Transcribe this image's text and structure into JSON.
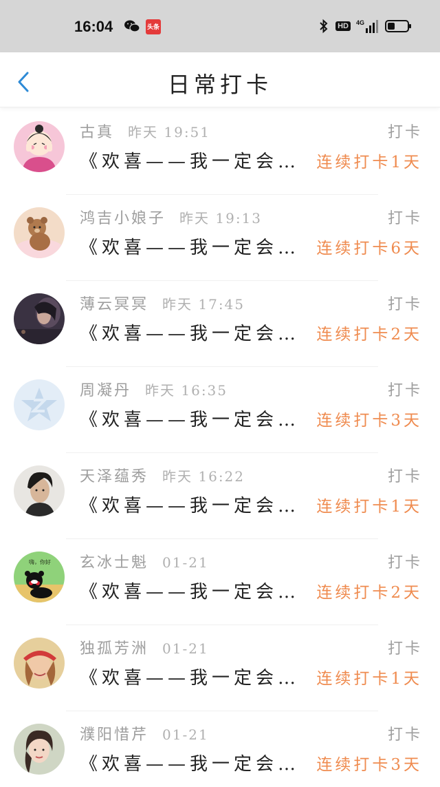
{
  "status_bar": {
    "time": "16:04",
    "toutiao_label": "头条",
    "network_label": "HD"
  },
  "nav": {
    "title": "日常打卡"
  },
  "colors": {
    "accent_orange": "#ef8b4f",
    "back_blue": "#2d8ad6"
  },
  "entries": [
    {
      "name": "古真",
      "time": "昨天 19:51",
      "tag": "打卡",
      "title": "《欢喜——我一定会带你去看极光》",
      "streak": "连续打卡1天",
      "avatar": "cartoon-girl"
    },
    {
      "name": "鸿吉小娘子",
      "time": "昨天 19:13",
      "tag": "打卡",
      "title": "《欢喜——我一定会带你去看极光》",
      "streak": "连续打卡6天",
      "avatar": "teddy-bear"
    },
    {
      "name": "薄云冥冥",
      "time": "昨天 17:45",
      "tag": "打卡",
      "title": "《欢喜——我一定会带你去看极光》",
      "streak": "连续打卡2天",
      "avatar": "dark-portrait"
    },
    {
      "name": "周凝丹",
      "time": "昨天 16:35",
      "tag": "打卡",
      "title": "《欢喜——我一定会带你去看极光》",
      "streak": "连续打卡3天",
      "avatar": "default-logo"
    },
    {
      "name": "天泽蕴秀",
      "time": "昨天 16:22",
      "tag": "打卡",
      "title": "《欢喜——我一定会带你去看极光》",
      "streak": "连续打卡1天",
      "avatar": "man-portrait"
    },
    {
      "name": "玄冰士魁",
      "time": "01-21",
      "tag": "打卡",
      "title": "《欢喜——我一定会带你去看极光》",
      "streak": "连续打卡2天",
      "avatar": "kumamon"
    },
    {
      "name": "独孤芳洲",
      "time": "01-21",
      "tag": "打卡",
      "title": "《欢喜——我一定会带你去看极光》",
      "streak": "连续打卡1天",
      "avatar": "girl-hat"
    },
    {
      "name": "濮阳惜芹",
      "time": "01-21",
      "tag": "打卡",
      "title": "《欢喜——我一定会带你去看极光》",
      "streak": "连续打卡3天",
      "avatar": "woman-portrait"
    }
  ],
  "avatar_texts": {
    "kumamon_caption": "嗨，你好"
  }
}
